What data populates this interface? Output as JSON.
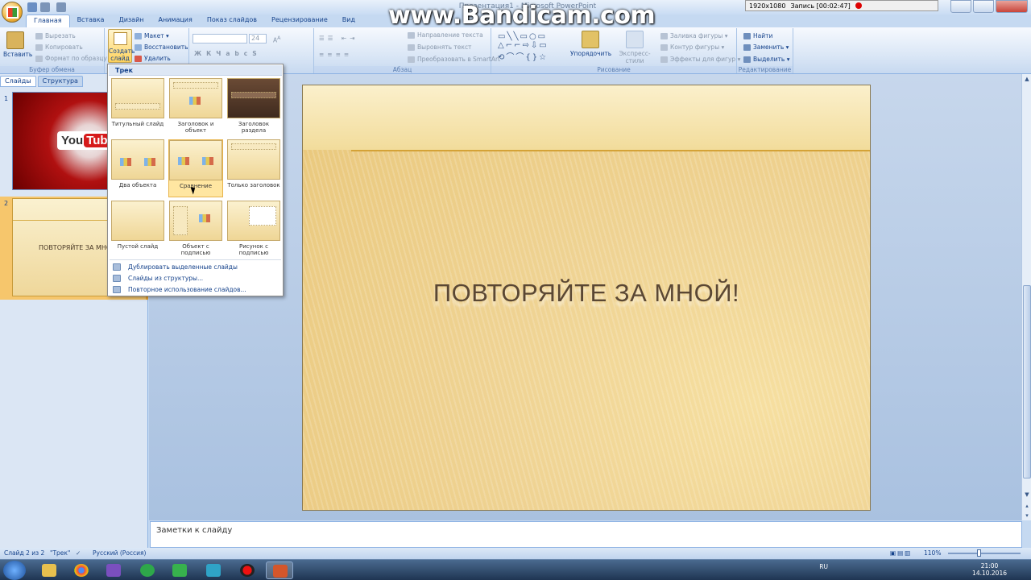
{
  "watermark": "www.Bandicam.com",
  "titlebar": {
    "doc_title": "Презентация1 - Microsoft PowerPoint"
  },
  "recorder": {
    "resolution": "1920x1080",
    "recording": "Запись [00:02:47]"
  },
  "tabs": [
    "Главная",
    "Вставка",
    "Дизайн",
    "Анимация",
    "Показ слайдов",
    "Рецензирование",
    "Вид"
  ],
  "ribbon": {
    "clipboard": {
      "paste": "Вставить",
      "cut": "Вырезать",
      "copy": "Копировать",
      "format_painter": "Формат по образцу",
      "label": "Буфер обмена"
    },
    "slides": {
      "create": "Создать слайд",
      "layout": "Макет",
      "reset": "Восстановить",
      "delete": "Удалить"
    },
    "font": {
      "size": "24"
    },
    "paragraph": {
      "text_direction": "Направление текста",
      "align_text": "Выровнять текст",
      "smartart": "Преобразовать в SmartArt",
      "label": "Абзац"
    },
    "drawing": {
      "arrange": "Упорядочить",
      "quick_styles": "Экспресс-стили",
      "fill": "Заливка фигуры",
      "outline": "Контур фигуры",
      "effects": "Эффекты для фигур",
      "label": "Рисование"
    },
    "editing": {
      "find": "Найти",
      "replace": "Заменить",
      "select": "Выделить",
      "label": "Редактирование"
    }
  },
  "left_pane": {
    "tabs": [
      "Слайды",
      "Структура"
    ],
    "slide1_num": "1",
    "slide1_logo": "You",
    "slide1_logo_tube": "Tube",
    "slide2_num": "2",
    "slide2_title": "ПОВТОРЯЙТЕ ЗА МНОЙ!"
  },
  "layout_menu": {
    "header": "Трек",
    "layouts": [
      {
        "label": "Титульный слайд"
      },
      {
        "label": "Заголовок и объект"
      },
      {
        "label": "Заголовок раздела"
      },
      {
        "label": "Два объекта"
      },
      {
        "label": "Сравнение"
      },
      {
        "label": "Только заголовок"
      },
      {
        "label": "Пустой слайд"
      },
      {
        "label": "Объект с подписью"
      },
      {
        "label": "Рисунок с подписью"
      }
    ],
    "items": [
      "Дублировать выделенные слайды",
      "Слайды из структуры...",
      "Повторное использование слайдов..."
    ]
  },
  "slide": {
    "title": "ПОВТОРЯЙТЕ ЗА МНОЙ!"
  },
  "notes": {
    "placeholder": "Заметки к слайду"
  },
  "statusbar": {
    "slide_count": "Слайд 2 из 2",
    "theme": "\"Трек\"",
    "language": "Русский (Россия)",
    "zoom": "110%"
  },
  "taskbar": {
    "lang": "RU",
    "time": "21:00",
    "date": "14.10.2016"
  },
  "colors": {
    "ribbon_bg": "#dbe7f6",
    "accent_orange": "#e8a233",
    "slide_bg": "#efd393",
    "title_text": "#5a4734"
  }
}
